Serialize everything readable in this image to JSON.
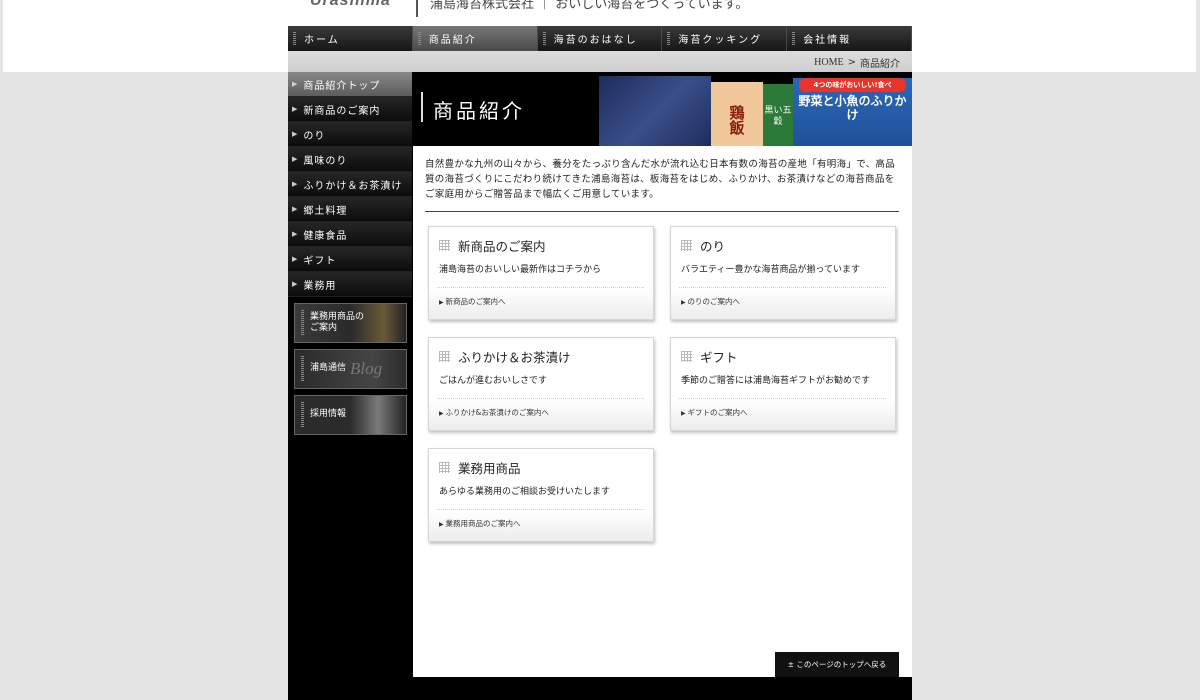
{
  "header": {
    "logo": "Urashima",
    "tagline": "浦島海苔株式会社 ｜ おいしい海苔をつくっています。"
  },
  "gnav": [
    {
      "label": "ホーム"
    },
    {
      "label": "商品紹介"
    },
    {
      "label": "海苔のおはなし"
    },
    {
      "label": "海苔クッキング"
    },
    {
      "label": "会社情報"
    }
  ],
  "breadcrumb": {
    "home": "HOME",
    "sep": ">",
    "current": "商品紹介"
  },
  "sidebar": {
    "items": [
      {
        "label": "商品紹介トップ"
      },
      {
        "label": "新商品のご案内"
      },
      {
        "label": "のり"
      },
      {
        "label": "風味のり"
      },
      {
        "label": "ふりかけ＆お茶漬け"
      },
      {
        "label": "郷土料理"
      },
      {
        "label": "健康食品"
      },
      {
        "label": "ギフト"
      },
      {
        "label": "業務用"
      }
    ],
    "banners": [
      {
        "line1": "業務用商品の",
        "line2": "ご案内"
      },
      {
        "line1": "浦島通信",
        "line2": "Blog"
      },
      {
        "line1": "採用情報",
        "line2": ""
      }
    ]
  },
  "hero": {
    "title": "商品紹介",
    "pkg1": "鶏飯",
    "pkg2": "黒い五穀",
    "pkg3": "野菜と小魚のふりかけ",
    "pkg3_badge": "4つの味がおいしい!食べ"
  },
  "intro": "自然豊かな九州の山々から、養分をたっぷり含んだ水が流れ込む日本有数の海苔の産地「有明海」で、高品質の海苔づくりにこだわり続けてきた浦島海苔は、板海苔をはじめ、ふりかけ、お茶漬けなどの海苔商品をご家庭用からご贈答品まで幅広くご用意しています。",
  "cards": [
    {
      "title": "新商品のご案内",
      "desc": "浦島海苔のおいしい最新作はコチラから",
      "link": "新商品のご案内へ"
    },
    {
      "title": "のり",
      "desc": "バラエティー豊かな海苔商品が揃っています",
      "link": "のりのご案内へ"
    },
    {
      "title": "ふりかけ＆お茶漬け",
      "desc": "ごはんが進むおいしさです",
      "link": "ふりかけ&お茶漬けのご案内へ"
    },
    {
      "title": "ギフト",
      "desc": "季節のご贈答には浦島海苔ギフトがお勧めです",
      "link": "ギフトのご案内へ"
    },
    {
      "title": "業務用商品",
      "desc": "あらゆる業務用のご相談お受けいたします",
      "link": "業務用商品のご案内へ"
    }
  ],
  "pagetop": "± このページのトップへ戻る",
  "colors": {
    "page_bg": "#e5e5e5",
    "frame": "#000000",
    "card_border": "#d6d6d6"
  }
}
